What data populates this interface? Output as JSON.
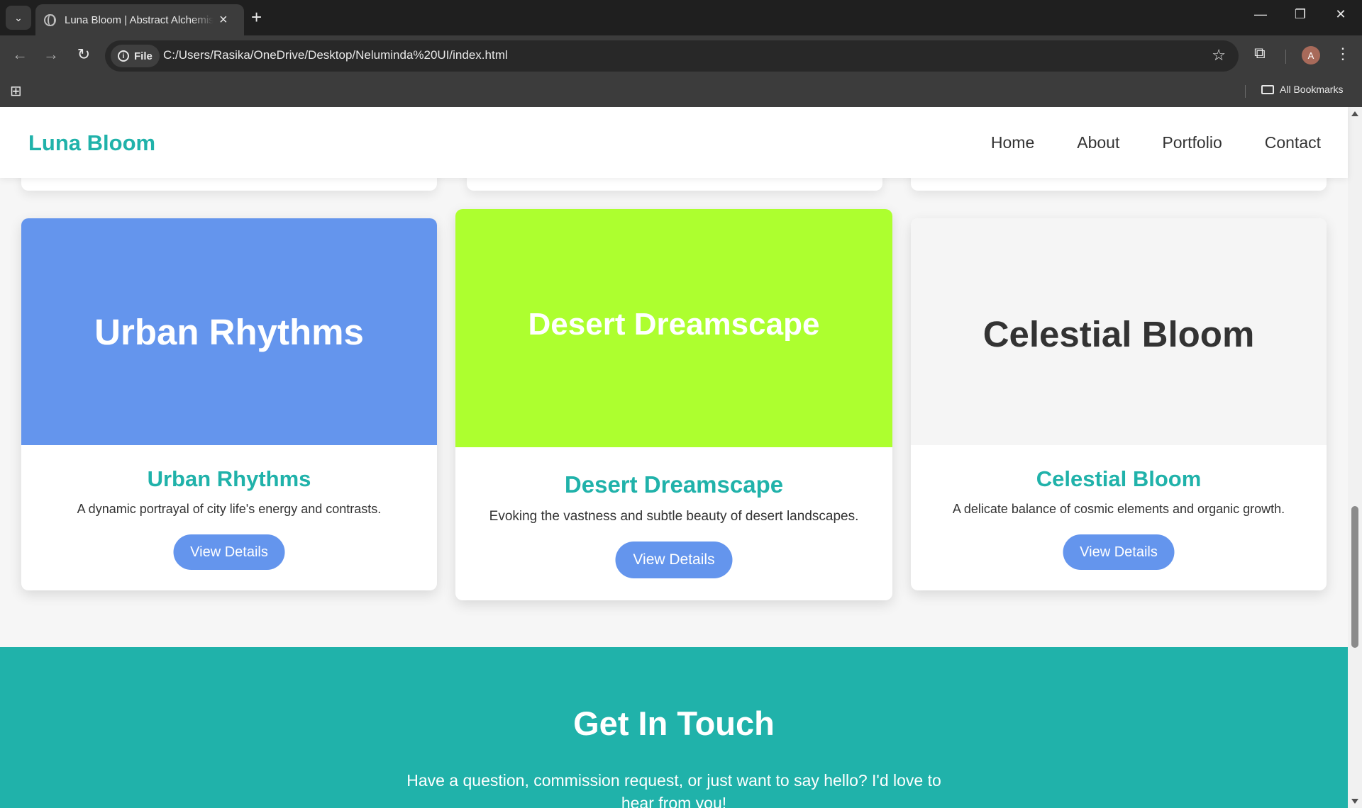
{
  "browser": {
    "tab_title": "Luna Bloom | Abstract Alchemist",
    "url_chip": "File",
    "url": "C:/Users/Rasika/OneDrive/Desktop/Neluminda%20UI/index.html",
    "bookmarks_label": "All Bookmarks",
    "profile_initial": "A",
    "profile_color": "#a86a5a"
  },
  "site": {
    "logo": "Luna Bloom",
    "nav": [
      "Home",
      "About",
      "Portfolio",
      "Contact"
    ],
    "accent_color": "#20b2aa",
    "button_color": "#6495ed"
  },
  "cards": [
    {
      "art_title": "Urban Rhythms",
      "art_bg": "#6495ed",
      "title": "Urban Rhythms",
      "description": "A dynamic portrayal of city life's energy and contrasts.",
      "button": "View Details"
    },
    {
      "art_title": "Desert Dreamscape",
      "art_bg": "#adff2f",
      "title": "Desert Dreamscape",
      "description": "Evoking the vastness and subtle beauty of desert landscapes.",
      "button": "View Details"
    },
    {
      "art_title": "Celestial Bloom",
      "art_bg": "#f5f5f5",
      "title": "Celestial Bloom",
      "description": "A delicate balance of cosmic elements and organic growth.",
      "button": "View Details"
    }
  ],
  "contact": {
    "heading": "Get In Touch",
    "text": "Have a question, commission request, or just want to say hello? I'd love to hear from you!"
  }
}
